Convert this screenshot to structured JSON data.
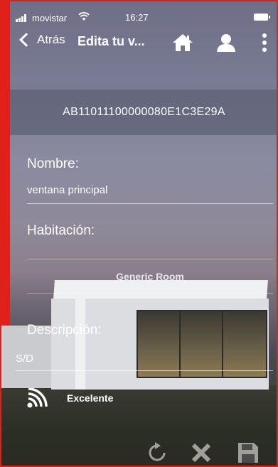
{
  "status_bar": {
    "carrier": "movistar",
    "time": "16:27"
  },
  "navbar": {
    "back_label": "Atrás",
    "title": "Edita tu v..."
  },
  "device_id": "AB11011100000080E1C3E29A",
  "form": {
    "name_label": "Nombre:",
    "name_value": "ventana principal",
    "room_label": "Habitación:",
    "room_value": "Generic Room",
    "description_label": "Descripción:",
    "description_value": "S/D"
  },
  "signal": {
    "quality": "Excelente"
  },
  "icons": {
    "back": "chevron-left-icon",
    "home": "home-icon",
    "user": "user-icon",
    "more": "more-vertical-icon",
    "signal": "wifi-signal-icon",
    "refresh": "refresh-icon",
    "cancel": "close-icon",
    "save": "save-icon"
  },
  "colors": {
    "accent_border": "#d9241b",
    "text": "#ffffff"
  }
}
